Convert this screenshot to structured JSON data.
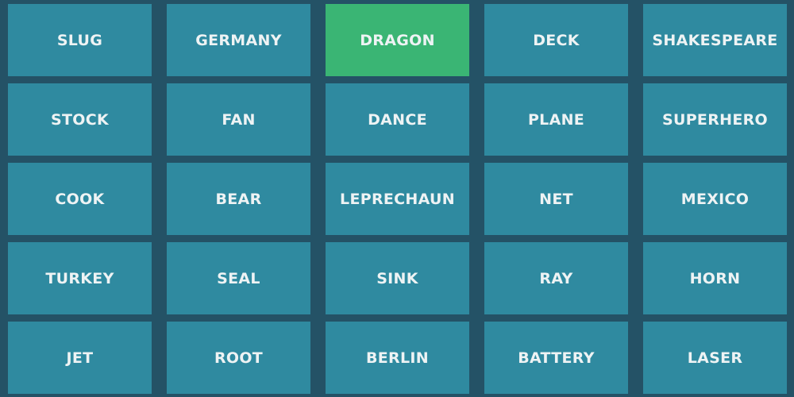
{
  "board": {
    "rows": [
      [
        {
          "word": "SLUG",
          "state": "hidden"
        },
        {
          "word": "GERMANY",
          "state": "hidden"
        },
        {
          "word": "DRAGON",
          "state": "revealed"
        },
        {
          "word": "DECK",
          "state": "hidden"
        },
        {
          "word": "SHAKESPEARE",
          "state": "hidden"
        }
      ],
      [
        {
          "word": "STOCK",
          "state": "hidden"
        },
        {
          "word": "FAN",
          "state": "hidden"
        },
        {
          "word": "DANCE",
          "state": "hidden"
        },
        {
          "word": "PLANE",
          "state": "hidden"
        },
        {
          "word": "SUPERHERO",
          "state": "hidden"
        }
      ],
      [
        {
          "word": "COOK",
          "state": "hidden"
        },
        {
          "word": "BEAR",
          "state": "hidden"
        },
        {
          "word": "LEPRECHAUN",
          "state": "hidden"
        },
        {
          "word": "NET",
          "state": "hidden"
        },
        {
          "word": "MEXICO",
          "state": "hidden"
        }
      ],
      [
        {
          "word": "TURKEY",
          "state": "hidden"
        },
        {
          "word": "SEAL",
          "state": "hidden"
        },
        {
          "word": "SINK",
          "state": "hidden"
        },
        {
          "word": "RAY",
          "state": "hidden"
        },
        {
          "word": "HORN",
          "state": "hidden"
        }
      ],
      [
        {
          "word": "JET",
          "state": "hidden"
        },
        {
          "word": "ROOT",
          "state": "hidden"
        },
        {
          "word": "BERLIN",
          "state": "hidden"
        },
        {
          "word": "BATTERY",
          "state": "hidden"
        },
        {
          "word": "LASER",
          "state": "hidden"
        }
      ]
    ]
  },
  "colors": {
    "background": "#245266",
    "card_hidden": "#2f8aa0",
    "card_revealed_green": "#3ab574",
    "text": "#eef3f4"
  }
}
